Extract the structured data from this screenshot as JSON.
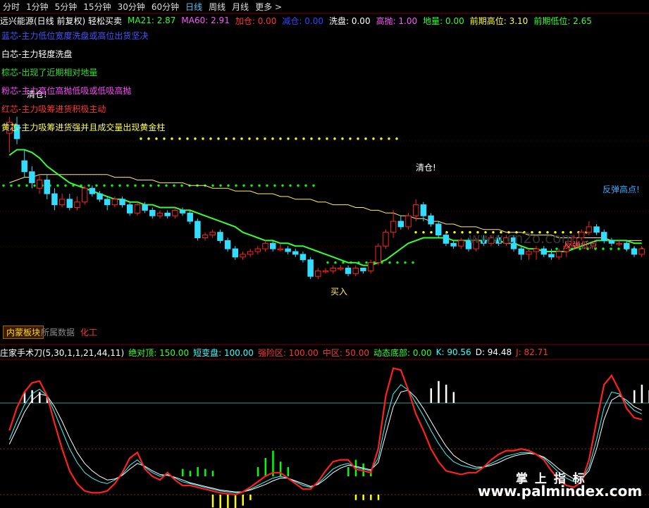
{
  "tabs": [
    "分时",
    "1分钟",
    "5分钟",
    "15分钟",
    "30分钟",
    "60分钟",
    "日线",
    "周线",
    "月线",
    "更多 >"
  ],
  "active_tab": "日线",
  "main_header": [
    {
      "text": "远兴能源(日线 前复权) 轻松买卖",
      "color": "#ffffff"
    },
    {
      "text": "MA21: 2.87",
      "color": "#33ff33"
    },
    {
      "text": "MA60: 2.91",
      "color": "#ff55ff"
    },
    {
      "text": "加仓: 0.00",
      "color": "#ff3333"
    },
    {
      "text": "减仓: 0.00",
      "color": "#3344ff"
    },
    {
      "text": "洗盘: 0.00",
      "color": "#ffffff"
    },
    {
      "text": "高抛: 1.00",
      "color": "#ff55ff"
    },
    {
      "text": "地量: 0.00",
      "color": "#33ff33"
    },
    {
      "text": "前期高位: 3.10",
      "color": "#ffff33"
    },
    {
      "text": "前期低位: 2.65",
      "color": "#33ff33"
    }
  ],
  "legend": [
    {
      "text": "蓝芯-主力低位宽度洗盘或高位出货坚决",
      "color": "#4455ff"
    },
    {
      "text": "白芯-主力轻度洗盘",
      "color": "#ffffff"
    },
    {
      "text": "棕芯-出现了近期相对地量",
      "color": "#33dd33"
    },
    {
      "text": "粉芯-主力高位高抛低吸或低吸高抛",
      "color": "#ff44ff"
    },
    {
      "text": "红芯-主力吸筹进货积极主动",
      "color": "#ff3333"
    },
    {
      "text": "黄芯-主力吸筹进货强并且成交量出现黄金柱",
      "color": "#ffff44"
    }
  ],
  "annotations": {
    "clear1": "清仓!",
    "clear2": "清仓!",
    "buy": "买入",
    "rebound_high": "反弹高点!",
    "rebound_low": "反弹低点"
  },
  "block_tab": {
    "label": "内蒙板块",
    "sub": "所属数据",
    "industry": "化工"
  },
  "sub_header": [
    {
      "text": "庄家手术刀(5,30,1,1,21,44,11)",
      "color": "#ffffff"
    },
    {
      "text": "绝对顶: 150.00",
      "color": "#33ff33"
    },
    {
      "text": "短变盘: 100.00",
      "color": "#33ffff"
    },
    {
      "text": "强险区: 100.00",
      "color": "#ff3333"
    },
    {
      "text": "中区: 50.00",
      "color": "#ff3333"
    },
    {
      "text": "动态底部: 0.00",
      "color": "#33ff33"
    },
    {
      "text": "K: 90.56",
      "color": "#33ffff"
    },
    {
      "text": "D: 94.48",
      "color": "#ffffff"
    },
    {
      "text": "J: 82.71",
      "color": "#ff3333"
    }
  ],
  "watermark": {
    "cn": "掌 上 指 标",
    "url": "www.palmindex.com",
    "faint": "www.cn2o.com"
  },
  "colors": {
    "up": "#ff2020",
    "down": "#33ddff",
    "ma21": "#33ff33",
    "ma60": "#ffee66",
    "k": "#33ffff",
    "d": "#ffffff",
    "j": "#ff2020",
    "dot_yellow": "#ffff00",
    "dot_green": "#00ff00"
  },
  "chart_data": [
    {
      "type": "candlestick",
      "title": "远兴能源(日线 前复权)",
      "ylim": [
        2.58,
        3.22
      ],
      "candles": [
        [
          3.12,
          3.16,
          3.05,
          3.18
        ],
        [
          3.15,
          3.1,
          3.08,
          3.18
        ],
        [
          3.02,
          2.98,
          2.96,
          3.06
        ],
        [
          2.98,
          2.94,
          2.92,
          3.0
        ],
        [
          2.92,
          2.95,
          2.9,
          2.97
        ],
        [
          2.95,
          2.9,
          2.88,
          2.97
        ],
        [
          2.9,
          2.86,
          2.84,
          2.92
        ],
        [
          2.86,
          2.88,
          2.85,
          2.9
        ],
        [
          2.88,
          2.85,
          2.84,
          2.9
        ],
        [
          2.85,
          2.87,
          2.84,
          2.89
        ],
        [
          2.87,
          2.92,
          2.86,
          2.93
        ],
        [
          2.92,
          2.9,
          2.89,
          2.93
        ],
        [
          2.9,
          2.88,
          2.87,
          2.91
        ],
        [
          2.88,
          2.86,
          2.84,
          2.89
        ],
        [
          2.86,
          2.88,
          2.85,
          2.89
        ],
        [
          2.88,
          2.86,
          2.85,
          2.89
        ],
        [
          2.86,
          2.83,
          2.82,
          2.87
        ],
        [
          2.83,
          2.86,
          2.82,
          2.87
        ],
        [
          2.86,
          2.84,
          2.83,
          2.87
        ],
        [
          2.84,
          2.82,
          2.81,
          2.85
        ],
        [
          2.82,
          2.83,
          2.81,
          2.84
        ],
        [
          2.83,
          2.82,
          2.81,
          2.84
        ],
        [
          2.82,
          2.84,
          2.81,
          2.85
        ],
        [
          2.84,
          2.83,
          2.82,
          2.85
        ],
        [
          2.83,
          2.8,
          2.79,
          2.84
        ],
        [
          2.8,
          2.74,
          2.73,
          2.81
        ],
        [
          2.74,
          2.75,
          2.73,
          2.76
        ],
        [
          2.75,
          2.76,
          2.74,
          2.77
        ],
        [
          2.76,
          2.73,
          2.72,
          2.77
        ],
        [
          2.73,
          2.7,
          2.69,
          2.74
        ],
        [
          2.7,
          2.67,
          2.66,
          2.71
        ],
        [
          2.67,
          2.68,
          2.66,
          2.69
        ],
        [
          2.68,
          2.69,
          2.67,
          2.7
        ],
        [
          2.69,
          2.7,
          2.68,
          2.71
        ],
        [
          2.7,
          2.72,
          2.69,
          2.73
        ],
        [
          2.72,
          2.7,
          2.69,
          2.73
        ],
        [
          2.7,
          2.7,
          2.69,
          2.72
        ],
        [
          2.7,
          2.69,
          2.68,
          2.71
        ],
        [
          2.69,
          2.68,
          2.67,
          2.7
        ],
        [
          2.68,
          2.66,
          2.65,
          2.69
        ],
        [
          2.66,
          2.6,
          2.59,
          2.67
        ],
        [
          2.6,
          2.62,
          2.59,
          2.63
        ],
        [
          2.62,
          2.62,
          2.61,
          2.63
        ],
        [
          2.62,
          2.63,
          2.61,
          2.64
        ],
        [
          2.63,
          2.63,
          2.62,
          2.64
        ],
        [
          2.63,
          2.61,
          2.6,
          2.64
        ],
        [
          2.61,
          2.63,
          2.6,
          2.64
        ],
        [
          2.63,
          2.62,
          2.61,
          2.63
        ],
        [
          2.62,
          2.65,
          2.61,
          2.66
        ],
        [
          2.65,
          2.71,
          2.64,
          2.72
        ],
        [
          2.71,
          2.76,
          2.7,
          2.77
        ],
        [
          2.76,
          2.8,
          2.74,
          2.84
        ],
        [
          2.8,
          2.78,
          2.77,
          2.82
        ],
        [
          2.78,
          2.82,
          2.77,
          2.83
        ],
        [
          2.82,
          2.86,
          2.8,
          2.88
        ],
        [
          2.86,
          2.82,
          2.8,
          2.87
        ],
        [
          2.82,
          2.79,
          2.78,
          2.83
        ],
        [
          2.79,
          2.75,
          2.74,
          2.8
        ],
        [
          2.75,
          2.72,
          2.71,
          2.76
        ],
        [
          2.72,
          2.71,
          2.7,
          2.73
        ],
        [
          2.71,
          2.73,
          2.7,
          2.74
        ],
        [
          2.73,
          2.7,
          2.69,
          2.74
        ],
        [
          2.7,
          2.73,
          2.69,
          2.74
        ],
        [
          2.73,
          2.72,
          2.71,
          2.75
        ],
        [
          2.72,
          2.74,
          2.71,
          2.75
        ],
        [
          2.74,
          2.72,
          2.71,
          2.75
        ],
        [
          2.72,
          2.74,
          2.71,
          2.75
        ],
        [
          2.74,
          2.7,
          2.69,
          2.75
        ],
        [
          2.7,
          2.68,
          2.66,
          2.71
        ],
        [
          2.68,
          2.69,
          2.66,
          2.7
        ],
        [
          2.69,
          2.7,
          2.66,
          2.71
        ],
        [
          2.7,
          2.68,
          2.67,
          2.71
        ],
        [
          2.68,
          2.67,
          2.66,
          2.7
        ],
        [
          2.67,
          2.69,
          2.66,
          2.7
        ],
        [
          2.69,
          2.71,
          2.67,
          2.72
        ],
        [
          2.71,
          2.74,
          2.7,
          2.75
        ],
        [
          2.74,
          2.76,
          2.73,
          2.77
        ],
        [
          2.76,
          2.78,
          2.75,
          2.8
        ],
        [
          2.78,
          2.76,
          2.75,
          2.79
        ],
        [
          2.76,
          2.73,
          2.72,
          2.77
        ],
        [
          2.73,
          2.72,
          2.71,
          2.74
        ],
        [
          2.72,
          2.72,
          2.71,
          2.73
        ],
        [
          2.72,
          2.7,
          2.69,
          2.73
        ],
        [
          2.7,
          2.68,
          2.67,
          2.71
        ],
        [
          2.68,
          2.7,
          2.67,
          2.71
        ]
      ],
      "ma21": [
        3.04,
        3.06,
        3.06,
        3.05,
        3.03,
        3.0,
        2.98,
        2.96,
        2.94,
        2.93,
        2.92,
        2.91,
        2.9,
        2.89,
        2.88,
        2.88,
        2.87,
        2.87,
        2.86,
        2.86,
        2.85,
        2.85,
        2.85,
        2.84,
        2.84,
        2.83,
        2.82,
        2.81,
        2.8,
        2.79,
        2.78,
        2.76,
        2.75,
        2.74,
        2.73,
        2.73,
        2.72,
        2.72,
        2.71,
        2.71,
        2.7,
        2.69,
        2.68,
        2.67,
        2.66,
        2.65,
        2.65,
        2.64,
        2.64,
        2.65,
        2.66,
        2.68,
        2.7,
        2.72,
        2.73,
        2.74,
        2.74,
        2.74,
        2.74,
        2.73,
        2.73,
        2.73,
        2.73,
        2.73,
        2.73,
        2.73,
        2.72,
        2.72,
        2.71,
        2.7,
        2.7,
        2.69,
        2.69,
        2.69,
        2.69,
        2.7,
        2.71,
        2.72,
        2.73,
        2.73,
        2.73,
        2.73,
        2.73,
        2.72,
        2.72
      ],
      "ma60": [
        2.94,
        2.95,
        2.96,
        2.96,
        2.97,
        2.97,
        2.97,
        2.97,
        2.97,
        2.97,
        2.97,
        2.97,
        2.97,
        2.97,
        2.96,
        2.96,
        2.96,
        2.95,
        2.95,
        2.95,
        2.94,
        2.94,
        2.94,
        2.94,
        2.93,
        2.93,
        2.93,
        2.92,
        2.92,
        2.92,
        2.91,
        2.91,
        2.91,
        2.9,
        2.9,
        2.9,
        2.89,
        2.89,
        2.88,
        2.88,
        2.88,
        2.87,
        2.87,
        2.86,
        2.86,
        2.86,
        2.85,
        2.85,
        2.84,
        2.84,
        2.83,
        2.83,
        2.82,
        2.82,
        2.81,
        2.81,
        2.8,
        2.8,
        2.79,
        2.79,
        2.78,
        2.78,
        2.78,
        2.77,
        2.77,
        2.77,
        2.76,
        2.76,
        2.76,
        2.75,
        2.75,
        2.75,
        2.75,
        2.74,
        2.74,
        2.74,
        2.74,
        2.74,
        2.74,
        2.74,
        2.73,
        2.73,
        2.73,
        2.73,
        2.73
      ],
      "level_high": 3.1,
      "level_low": 2.65
    },
    {
      "type": "line",
      "title": "庄家手术刀",
      "ylim": [
        -10,
        140
      ],
      "series": [
        {
          "name": "K",
          "values": [
            60,
            80,
            98,
            110,
            115,
            108,
            90,
            70,
            50,
            35,
            24,
            18,
            14,
            12,
            16,
            22,
            32,
            38,
            30,
            24,
            20,
            22,
            18,
            14,
            12,
            10,
            8,
            6,
            4,
            3,
            2,
            3,
            6,
            10,
            14,
            18,
            20,
            18,
            14,
            10,
            8,
            12,
            20,
            28,
            32,
            34,
            30,
            28,
            26,
            40,
            80,
            110,
            120,
            114,
            100,
            86,
            70,
            56,
            44,
            36,
            32,
            30,
            28,
            30,
            34,
            38,
            42,
            44,
            46,
            46,
            44,
            40,
            32,
            24,
            18,
            14,
            16,
            30,
            60,
            95,
            112,
            110,
            100,
            92,
            88
          ]
        },
        {
          "name": "D",
          "values": [
            55,
            72,
            90,
            103,
            110,
            108,
            96,
            80,
            62,
            46,
            34,
            26,
            20,
            16,
            17,
            21,
            28,
            34,
            31,
            26,
            22,
            21,
            19,
            16,
            13,
            11,
            9,
            7,
            5,
            4,
            3,
            3,
            5,
            8,
            11,
            15,
            18,
            18,
            15,
            12,
            9,
            11,
            17,
            24,
            29,
            32,
            31,
            29,
            27,
            35,
            66,
            96,
            112,
            114,
            106,
            94,
            80,
            66,
            53,
            43,
            37,
            33,
            30,
            30,
            32,
            35,
            39,
            42,
            44,
            45,
            44,
            41,
            35,
            28,
            22,
            17,
            17,
            26,
            50,
            82,
            103,
            108,
            103,
            96,
            92
          ]
        },
        {
          "name": "J",
          "values": [
            70,
            95,
            112,
            122,
            124,
            108,
            78,
            50,
            26,
            12,
            4,
            2,
            2,
            4,
            12,
            24,
            40,
            46,
            28,
            20,
            16,
            24,
            16,
            10,
            10,
            8,
            6,
            4,
            2,
            1,
            0,
            3,
            8,
            14,
            20,
            24,
            24,
            18,
            12,
            6,
            6,
            14,
            26,
            36,
            38,
            38,
            28,
            26,
            24,
            50,
            108,
            138,
            136,
            114,
            88,
            70,
            50,
            36,
            26,
            24,
            22,
            24,
            24,
            30,
            38,
            44,
            48,
            48,
            50,
            48,
            44,
            38,
            26,
            16,
            10,
            8,
            14,
            38,
            80,
            120,
            130,
            114,
            94,
            84,
            82
          ]
        }
      ],
      "reference_lines": [
        100,
        50,
        0
      ],
      "histogram": [
        {
          "i": 2,
          "v": 12,
          "c": "#ffffff"
        },
        {
          "i": 3,
          "v": 14,
          "c": "#ffffff"
        },
        {
          "i": 4,
          "v": 12,
          "c": "#ffffff"
        },
        {
          "i": 5,
          "v": 8,
          "c": "#ffffff"
        },
        {
          "i": 23,
          "v": 8,
          "c": "#00ff00"
        },
        {
          "i": 24,
          "v": 6,
          "c": "#00ff00"
        },
        {
          "i": 25,
          "v": 10,
          "c": "#00ff00"
        },
        {
          "i": 26,
          "v": 8,
          "c": "#00ff00"
        },
        {
          "i": 27,
          "v": 6,
          "c": "#00ff00"
        },
        {
          "i": 33,
          "v": 10,
          "c": "#00ff00"
        },
        {
          "i": 34,
          "v": 20,
          "c": "#00ff00"
        },
        {
          "i": 35,
          "v": 28,
          "c": "#00ff00"
        },
        {
          "i": 36,
          "v": 16,
          "c": "#00ff00"
        },
        {
          "i": 37,
          "v": 10,
          "c": "#00ff00"
        },
        {
          "i": 45,
          "v": 10,
          "c": "#00ff00"
        },
        {
          "i": 46,
          "v": 18,
          "c": "#00ff00"
        },
        {
          "i": 47,
          "v": 14,
          "c": "#00ff00"
        },
        {
          "i": 48,
          "v": 8,
          "c": "#00ff00"
        },
        {
          "i": 27,
          "v": -14,
          "c": "#ffff00"
        },
        {
          "i": 28,
          "v": -20,
          "c": "#ffff00"
        },
        {
          "i": 29,
          "v": -26,
          "c": "#ffff00"
        },
        {
          "i": 30,
          "v": -22,
          "c": "#ffff00"
        },
        {
          "i": 31,
          "v": -12,
          "c": "#ffff00"
        },
        {
          "i": 32,
          "v": -6,
          "c": "#ffff00"
        },
        {
          "i": 46,
          "v": -6,
          "c": "#ffff00"
        },
        {
          "i": 47,
          "v": -6,
          "c": "#ffff00"
        },
        {
          "i": 48,
          "v": -6,
          "c": "#ffff00"
        },
        {
          "i": 49,
          "v": -6,
          "c": "#ffff00"
        },
        {
          "i": 56,
          "v": 16,
          "c": "#ffffff"
        },
        {
          "i": 57,
          "v": 24,
          "c": "#ffffff"
        },
        {
          "i": 58,
          "v": 20,
          "c": "#ffffff"
        },
        {
          "i": 59,
          "v": 12,
          "c": "#ffffff"
        },
        {
          "i": 83,
          "v": 14,
          "c": "#ffffff"
        },
        {
          "i": 84,
          "v": 20,
          "c": "#ffffff"
        },
        {
          "i": 85,
          "v": 14,
          "c": "#ffffff"
        }
      ]
    }
  ]
}
